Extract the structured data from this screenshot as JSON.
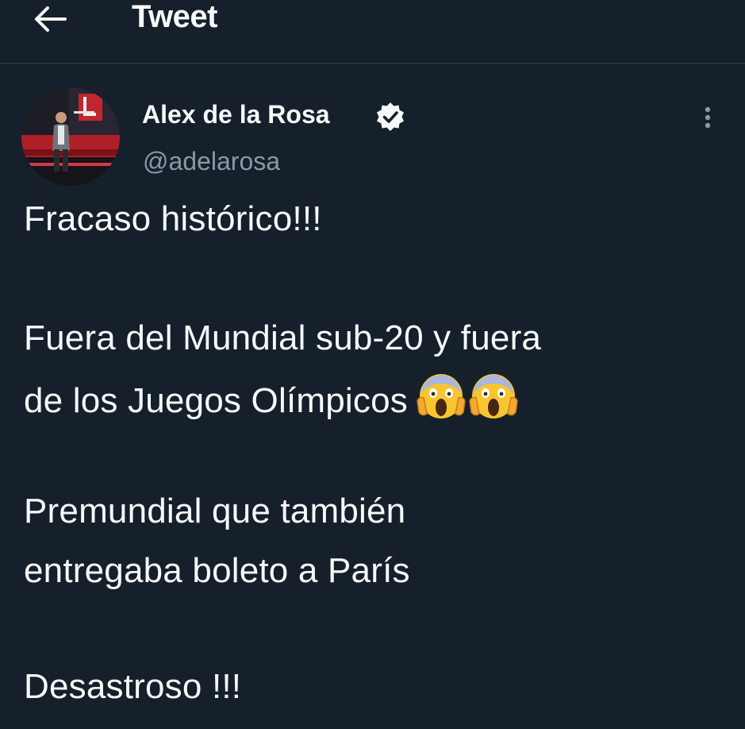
{
  "header": {
    "title": "Tweet",
    "back_icon": "arrow-left-icon"
  },
  "author": {
    "display_name": "Alex de la Rosa",
    "handle": "@adelarosa",
    "verified": true,
    "verified_icon": "verified-badge-icon",
    "avatar_icon": "avatar-photo"
  },
  "menu": {
    "more_icon": "more-vertical-icon"
  },
  "tweet": {
    "lines": [
      "Fracaso histórico!!!",
      "Fuera del Mundial sub-20 y fuera",
      "de los Juegos Olímpicos",
      "Premundial que también",
      "entregaba boleto a París",
      "Desastroso !!!"
    ],
    "emojis": [
      "screaming-face-emoji",
      "screaming-face-emoji"
    ]
  },
  "colors": {
    "background": "#15202b",
    "text": "#f7f9f9",
    "secondary_text": "#8b98a5",
    "divider": "#38444d"
  }
}
